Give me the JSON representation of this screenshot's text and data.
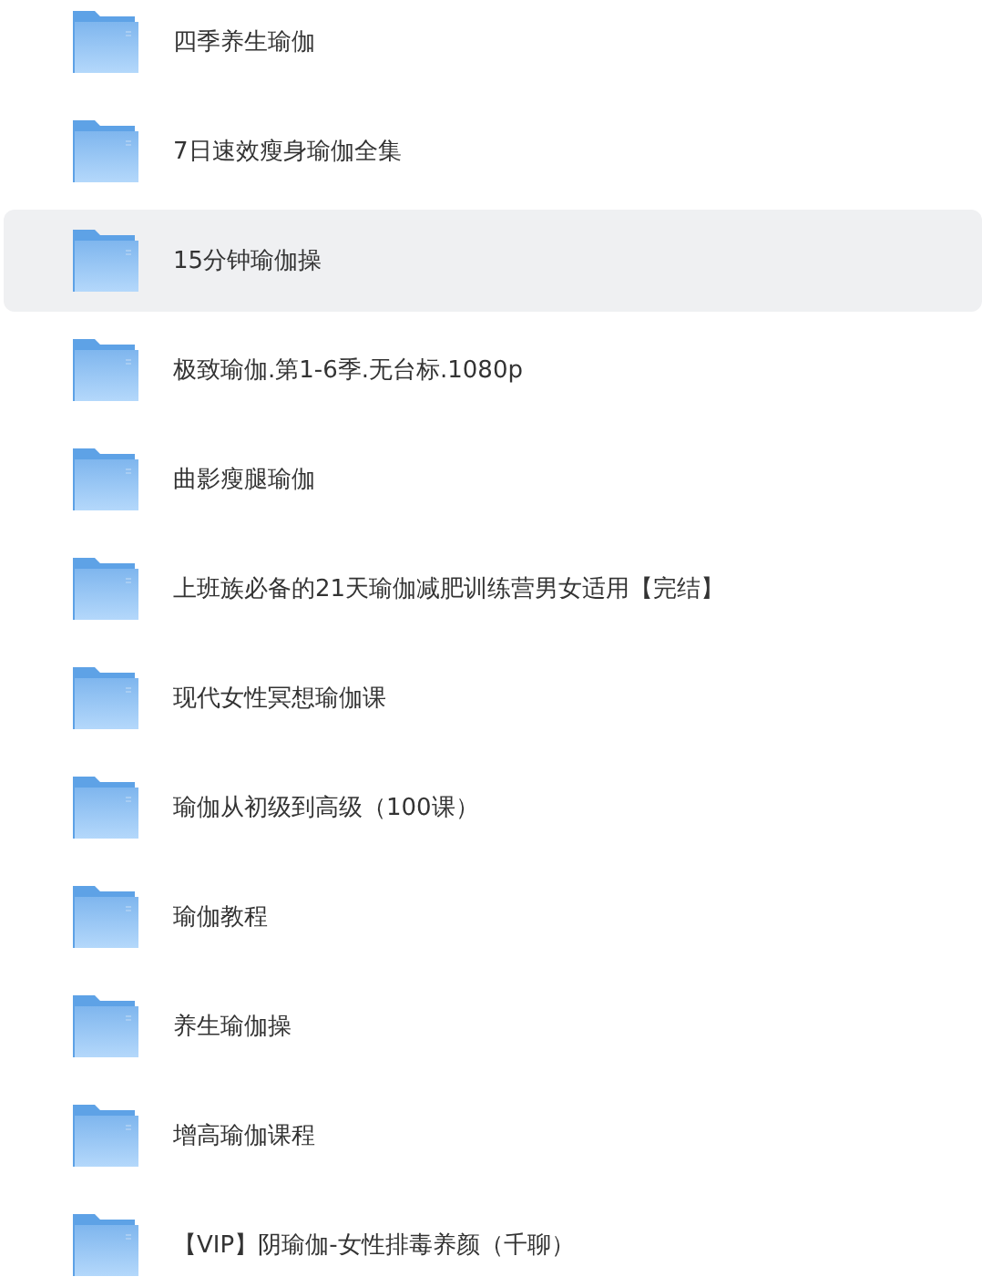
{
  "folders": [
    {
      "name": "四季养生瑜伽",
      "selected": false
    },
    {
      "name": "7日速效瘦身瑜伽全集",
      "selected": false
    },
    {
      "name": "15分钟瑜伽操",
      "selected": true
    },
    {
      "name": "极致瑜伽.第1-6季.无台标.1080p",
      "selected": false
    },
    {
      "name": "曲影瘦腿瑜伽",
      "selected": false
    },
    {
      "name": "上班族必备的21天瑜伽减肥训练营男女适用【完结】",
      "selected": false
    },
    {
      "name": "现代女性冥想瑜伽课",
      "selected": false
    },
    {
      "name": "瑜伽从初级到高级（100课）",
      "selected": false
    },
    {
      "name": "瑜伽教程",
      "selected": false
    },
    {
      "name": "养生瑜伽操",
      "selected": false
    },
    {
      "name": "增高瑜伽课程",
      "selected": false
    },
    {
      "name": "【VIP】阴瑜伽-女性排毒养颜（千聊）",
      "selected": false
    }
  ]
}
